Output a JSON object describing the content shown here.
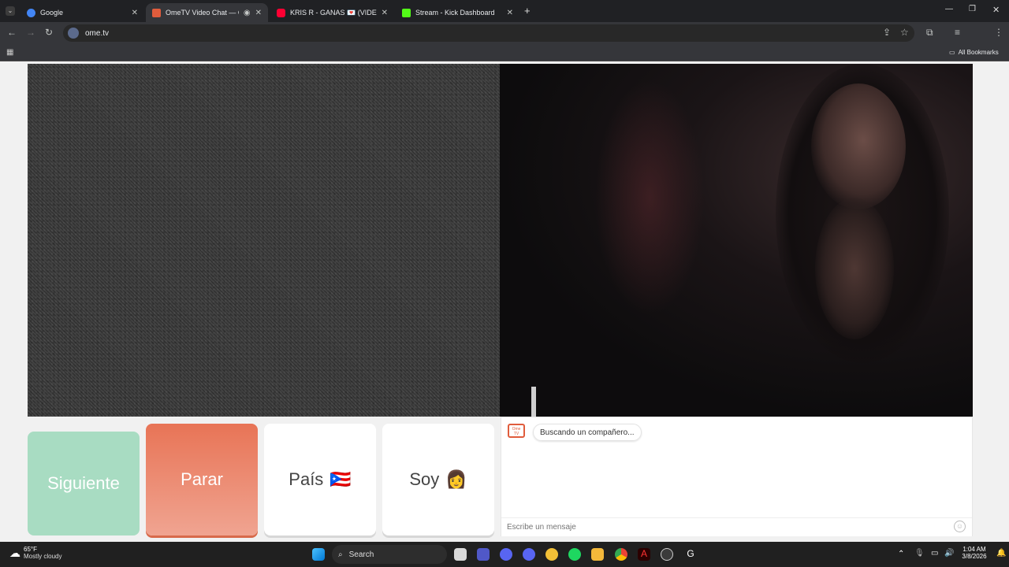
{
  "browser": {
    "tabs": [
      {
        "title": "Google",
        "favicon_color": "#4285f4"
      },
      {
        "title": "OmeTV Video Chat — Ome",
        "favicon_color": "#e05c3c",
        "active": true
      },
      {
        "title": "KRIS R - GANAS 💌 (VIDEO OF",
        "favicon_color": "#ff0000"
      },
      {
        "title": "Stream - Kick Dashboard",
        "favicon_color": "#53fc18"
      }
    ],
    "url": "ome.tv",
    "bookmarks_label": "All Bookmarks"
  },
  "page": {
    "buttons": {
      "next": "Siguiente",
      "stop": "Parar",
      "country": "País",
      "country_flag": "🇵🇷",
      "gender": "Soy",
      "gender_emoji": "👩"
    },
    "chat": {
      "logo_text": "Ome TV",
      "status": "Buscando un compañero...",
      "input_placeholder": "Escribe un mensaje"
    }
  },
  "taskbar": {
    "weather_temp": "65°F",
    "weather_desc": "Mostly cloudy",
    "search_label": "Search",
    "time": "1:04 AM",
    "date": "3/8/2026"
  }
}
